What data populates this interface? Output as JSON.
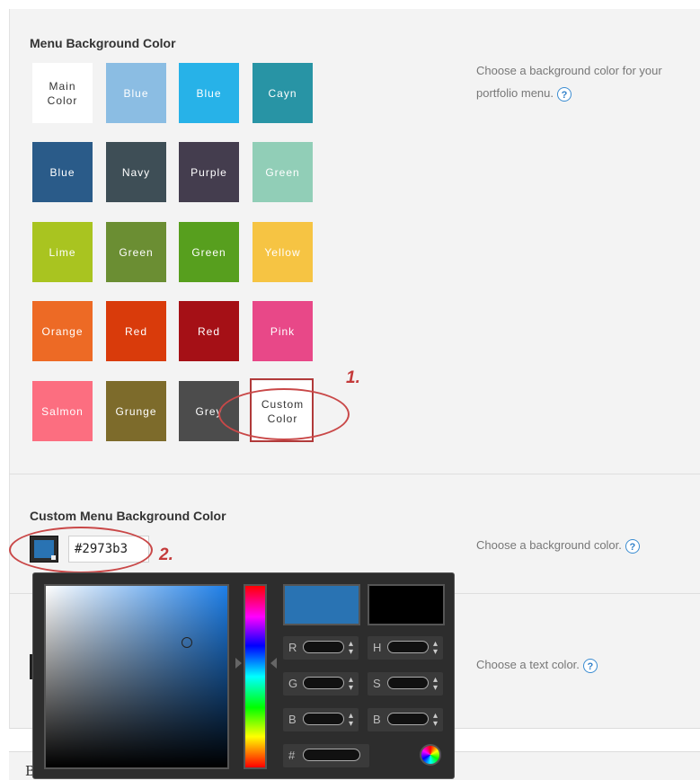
{
  "menu_background": {
    "title": "Menu Background Color",
    "description": "Choose a background color for your portfolio menu.",
    "swatches": [
      {
        "label": "Main\nColor",
        "color": "#ffffff"
      },
      {
        "label": "Blue",
        "color": "#8bbde3"
      },
      {
        "label": "Blue",
        "color": "#27b2e8"
      },
      {
        "label": "Cayn",
        "color": "#2894a5"
      },
      {
        "label": "Blue",
        "color": "#2a5b89"
      },
      {
        "label": "Navy",
        "color": "#3e4e56"
      },
      {
        "label": "Purple",
        "color": "#443d4e"
      },
      {
        "label": "Green",
        "color": "#91ceb7"
      },
      {
        "label": "Lime",
        "color": "#a9c420"
      },
      {
        "label": "Green",
        "color": "#6b8e33"
      },
      {
        "label": "Green",
        "color": "#579f1e"
      },
      {
        "label": "Yellow",
        "color": "#f6c443"
      },
      {
        "label": "Orange",
        "color": "#ed6a25"
      },
      {
        "label": "Red",
        "color": "#d93b0b"
      },
      {
        "label": "Red",
        "color": "#a51016"
      },
      {
        "label": "Pink",
        "color": "#e84888"
      },
      {
        "label": "Salmon",
        "color": "#fc6e80"
      },
      {
        "label": "Grunge",
        "color": "#7d6b2b"
      },
      {
        "label": "Grey",
        "color": "#4c4c4c"
      },
      {
        "label": "Custom\nColor",
        "color": "#ffffff"
      }
    ]
  },
  "annotations": {
    "step1": "1.",
    "step2": "2."
  },
  "custom_menu_background": {
    "title": "Custom Menu Background Color",
    "description": "Choose a background color.",
    "hex_value": "#2973b3",
    "swatch_color": "#2973b3"
  },
  "text_color": {
    "description": "Choose a text color."
  },
  "color_picker": {
    "new_color": "#2973b3",
    "current_color": "#000000",
    "fields": [
      {
        "label": "R",
        "value": ""
      },
      {
        "label": "H",
        "value": ""
      },
      {
        "label": "G",
        "value": ""
      },
      {
        "label": "S",
        "value": ""
      },
      {
        "label": "B",
        "value": ""
      },
      {
        "label": "B",
        "value": ""
      },
      {
        "label": "#",
        "value": ""
      }
    ]
  },
  "help_icon_glyph": "?",
  "footer_fragment": "B"
}
